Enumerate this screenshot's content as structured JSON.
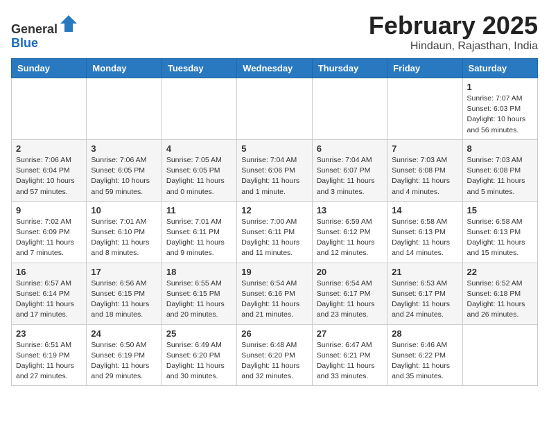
{
  "header": {
    "logo_general": "General",
    "logo_blue": "Blue",
    "month_title": "February 2025",
    "location": "Hindaun, Rajasthan, India"
  },
  "days_of_week": [
    "Sunday",
    "Monday",
    "Tuesday",
    "Wednesday",
    "Thursday",
    "Friday",
    "Saturday"
  ],
  "weeks": [
    [
      {
        "day": "",
        "info": ""
      },
      {
        "day": "",
        "info": ""
      },
      {
        "day": "",
        "info": ""
      },
      {
        "day": "",
        "info": ""
      },
      {
        "day": "",
        "info": ""
      },
      {
        "day": "",
        "info": ""
      },
      {
        "day": "1",
        "info": "Sunrise: 7:07 AM\nSunset: 6:03 PM\nDaylight: 10 hours and 56 minutes."
      }
    ],
    [
      {
        "day": "2",
        "info": "Sunrise: 7:06 AM\nSunset: 6:04 PM\nDaylight: 10 hours and 57 minutes."
      },
      {
        "day": "3",
        "info": "Sunrise: 7:06 AM\nSunset: 6:05 PM\nDaylight: 10 hours and 59 minutes."
      },
      {
        "day": "4",
        "info": "Sunrise: 7:05 AM\nSunset: 6:05 PM\nDaylight: 11 hours and 0 minutes."
      },
      {
        "day": "5",
        "info": "Sunrise: 7:04 AM\nSunset: 6:06 PM\nDaylight: 11 hours and 1 minute."
      },
      {
        "day": "6",
        "info": "Sunrise: 7:04 AM\nSunset: 6:07 PM\nDaylight: 11 hours and 3 minutes."
      },
      {
        "day": "7",
        "info": "Sunrise: 7:03 AM\nSunset: 6:08 PM\nDaylight: 11 hours and 4 minutes."
      },
      {
        "day": "8",
        "info": "Sunrise: 7:03 AM\nSunset: 6:08 PM\nDaylight: 11 hours and 5 minutes."
      }
    ],
    [
      {
        "day": "9",
        "info": "Sunrise: 7:02 AM\nSunset: 6:09 PM\nDaylight: 11 hours and 7 minutes."
      },
      {
        "day": "10",
        "info": "Sunrise: 7:01 AM\nSunset: 6:10 PM\nDaylight: 11 hours and 8 minutes."
      },
      {
        "day": "11",
        "info": "Sunrise: 7:01 AM\nSunset: 6:11 PM\nDaylight: 11 hours and 9 minutes."
      },
      {
        "day": "12",
        "info": "Sunrise: 7:00 AM\nSunset: 6:11 PM\nDaylight: 11 hours and 11 minutes."
      },
      {
        "day": "13",
        "info": "Sunrise: 6:59 AM\nSunset: 6:12 PM\nDaylight: 11 hours and 12 minutes."
      },
      {
        "day": "14",
        "info": "Sunrise: 6:58 AM\nSunset: 6:13 PM\nDaylight: 11 hours and 14 minutes."
      },
      {
        "day": "15",
        "info": "Sunrise: 6:58 AM\nSunset: 6:13 PM\nDaylight: 11 hours and 15 minutes."
      }
    ],
    [
      {
        "day": "16",
        "info": "Sunrise: 6:57 AM\nSunset: 6:14 PM\nDaylight: 11 hours and 17 minutes."
      },
      {
        "day": "17",
        "info": "Sunrise: 6:56 AM\nSunset: 6:15 PM\nDaylight: 11 hours and 18 minutes."
      },
      {
        "day": "18",
        "info": "Sunrise: 6:55 AM\nSunset: 6:15 PM\nDaylight: 11 hours and 20 minutes."
      },
      {
        "day": "19",
        "info": "Sunrise: 6:54 AM\nSunset: 6:16 PM\nDaylight: 11 hours and 21 minutes."
      },
      {
        "day": "20",
        "info": "Sunrise: 6:54 AM\nSunset: 6:17 PM\nDaylight: 11 hours and 23 minutes."
      },
      {
        "day": "21",
        "info": "Sunrise: 6:53 AM\nSunset: 6:17 PM\nDaylight: 11 hours and 24 minutes."
      },
      {
        "day": "22",
        "info": "Sunrise: 6:52 AM\nSunset: 6:18 PM\nDaylight: 11 hours and 26 minutes."
      }
    ],
    [
      {
        "day": "23",
        "info": "Sunrise: 6:51 AM\nSunset: 6:19 PM\nDaylight: 11 hours and 27 minutes."
      },
      {
        "day": "24",
        "info": "Sunrise: 6:50 AM\nSunset: 6:19 PM\nDaylight: 11 hours and 29 minutes."
      },
      {
        "day": "25",
        "info": "Sunrise: 6:49 AM\nSunset: 6:20 PM\nDaylight: 11 hours and 30 minutes."
      },
      {
        "day": "26",
        "info": "Sunrise: 6:48 AM\nSunset: 6:20 PM\nDaylight: 11 hours and 32 minutes."
      },
      {
        "day": "27",
        "info": "Sunrise: 6:47 AM\nSunset: 6:21 PM\nDaylight: 11 hours and 33 minutes."
      },
      {
        "day": "28",
        "info": "Sunrise: 6:46 AM\nSunset: 6:22 PM\nDaylight: 11 hours and 35 minutes."
      },
      {
        "day": "",
        "info": ""
      }
    ]
  ]
}
